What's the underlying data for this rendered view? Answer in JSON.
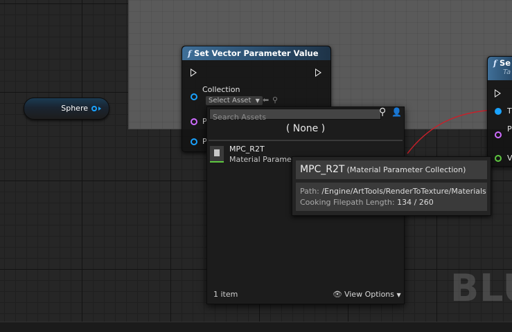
{
  "graph": {
    "watermark": "BLU",
    "variable_node": {
      "label": "Sphere"
    },
    "set_vector_node": {
      "title": "Set Vector Parameter Value",
      "collection_pin_label": "Collection",
      "asset_combo": "Select Asset",
      "param_pin_label": "P",
      "value_pin_label": "P"
    },
    "right_node": {
      "title": "Se",
      "subtitle": "Ta",
      "pins": [
        "T",
        "P",
        "V"
      ]
    }
  },
  "picker": {
    "search_placeholder": "Search Assets",
    "none_label": "( None )",
    "asset": {
      "name": "MPC_R2T",
      "type": "Material Parameter Collection"
    },
    "asset_type_truncated": "Material Parame",
    "item_count": "1 item",
    "view_options": "View Options"
  },
  "tooltip": {
    "name": "MPC_R2T",
    "class": "(Material Parameter Collection)",
    "path_label": "Path:",
    "path_value": "/Engine/ArtTools/RenderToTexture/Materials",
    "length_label": "Cooking Filepath Length:",
    "length_value": "134 / 260"
  },
  "colors": {
    "object_pin": "#1aa3ff",
    "name_pin": "#cf6cff",
    "vector_pin": "#ffc53d",
    "exec_pin": "#e8e8e8",
    "wire": "#c8202a",
    "material_asset_accent": "#5ec940"
  }
}
